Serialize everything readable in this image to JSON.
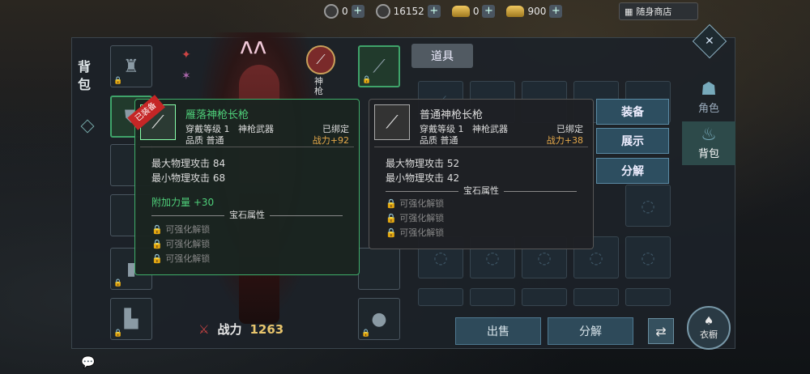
{
  "topbar": {
    "currencies": [
      {
        "icon": "coin-icon",
        "value": "0"
      },
      {
        "icon": "coin-locked-icon",
        "value": "16152"
      },
      {
        "icon": "gold-ingot-icon",
        "value": "0"
      },
      {
        "icon": "gold-ingot-locked-icon",
        "value": "900"
      }
    ],
    "shop_label": "随身商店"
  },
  "bag": {
    "title": "背包",
    "weapon_label": "神枪",
    "power_label": "战力",
    "power_value": "1263",
    "tab_label": "道具"
  },
  "tooltip_equipped": {
    "badge": "已装备",
    "name": "雁落神枪长枪",
    "req": "穿戴等级 1",
    "type": "神枪武器",
    "bind": "已绑定",
    "quality": "品质 普通",
    "power": "战力+92",
    "stats": [
      "最大物理攻击 84",
      "最小物理攻击 68"
    ],
    "bonus": "附加力量 +30",
    "gem_header": "宝石属性",
    "locks": [
      "可强化解锁",
      "可强化解锁",
      "可强化解锁"
    ]
  },
  "tooltip_compare": {
    "name": "普通神枪长枪",
    "req": "穿戴等级 1",
    "type": "神枪武器",
    "bind": "已绑定",
    "quality": "品质 普通",
    "power": "战力+38",
    "stats": [
      "最大物理攻击 52",
      "最小物理攻击 42"
    ],
    "gem_header": "宝石属性",
    "locks": [
      "可强化解锁",
      "可强化解锁",
      "可强化解锁"
    ]
  },
  "actions": {
    "equip": "装备",
    "show": "展示",
    "decompose": "分解"
  },
  "bottom": {
    "sell": "出售",
    "decompose": "分解"
  },
  "side": {
    "role": "角色",
    "bag": "背包",
    "wardrobe": "衣橱"
  },
  "colors": {
    "green": "#3fae6a",
    "power": "#e8c46c"
  }
}
